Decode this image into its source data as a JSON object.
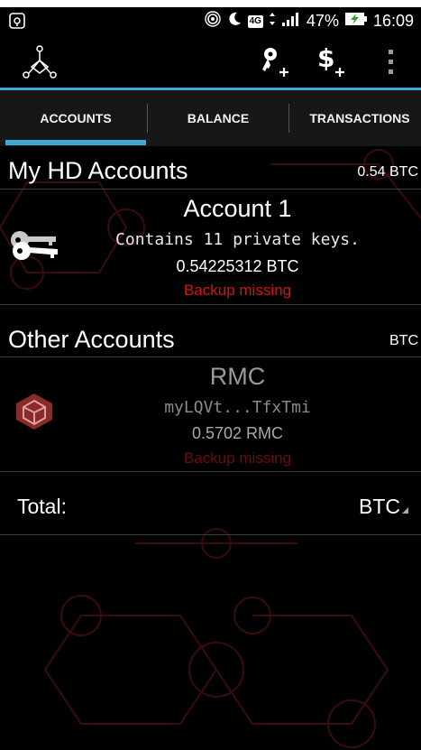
{
  "status_bar": {
    "battery": "47%",
    "time": "16:09",
    "network": "4G"
  },
  "tabs": [
    {
      "label": "ACCOUNTS",
      "active": true
    },
    {
      "label": "BALANCE",
      "active": false
    },
    {
      "label": "TRANSACTIONS",
      "active": false
    }
  ],
  "hd_accounts": {
    "header": "My HD Accounts",
    "header_right": "0.54 BTC",
    "items": [
      {
        "name": "Account 1",
        "details": "Contains 11 private keys.",
        "balance": "0.54225312 BTC",
        "warning": "Backup missing"
      }
    ]
  },
  "other_accounts": {
    "header": "Other Accounts",
    "header_right": "BTC",
    "items": [
      {
        "name": "RMC",
        "address": "myLQVt...TfxTmi",
        "balance": "0.5702 RMC",
        "warning": "Backup missing"
      }
    ]
  },
  "total": {
    "label": "Total:",
    "currency": "BTC"
  },
  "colors": {
    "accent": "#3fa7d6",
    "warning": "#d81313",
    "background": "#000000",
    "deco": "#5a1212"
  }
}
